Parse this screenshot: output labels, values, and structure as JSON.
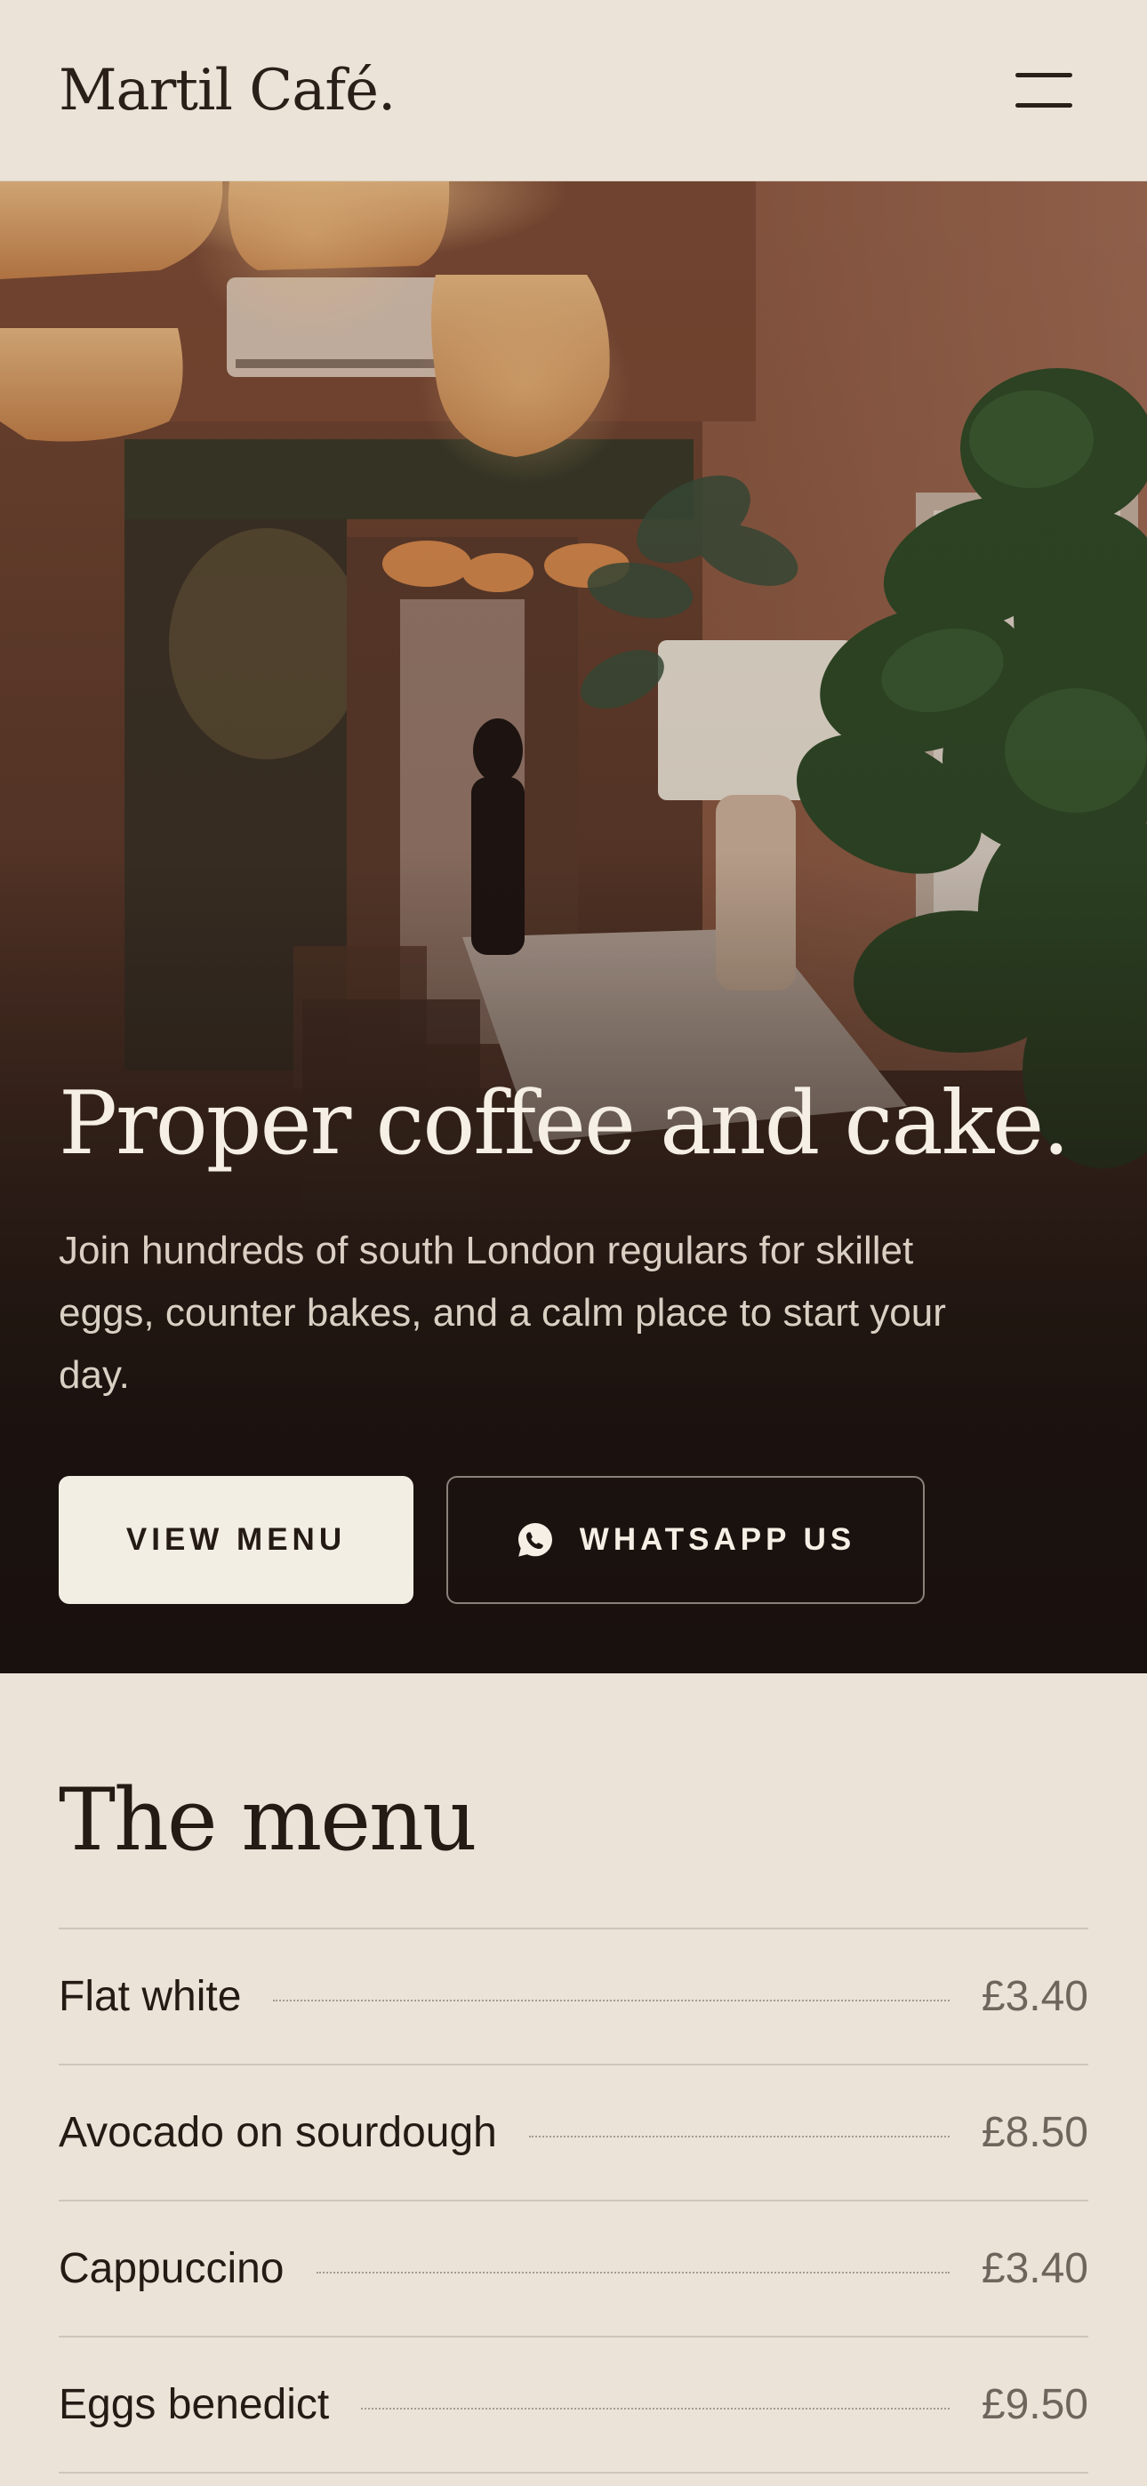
{
  "header": {
    "logo": "Martil Café.",
    "menu_icon": "hamburger-menu-icon"
  },
  "hero": {
    "image_description": "Photo of cafe interior",
    "title": "Proper coffee and cake.",
    "subtitle": "Join hundreds of south London regulars for skillet eggs, counter bakes, and a calm place to start your day.",
    "primary_button": "VIEW MENU",
    "secondary_button": "WHATSAPP US",
    "secondary_button_icon": "whatsapp-icon"
  },
  "menu": {
    "heading": "The menu",
    "items": [
      {
        "name": "Flat white",
        "price": "£3.40"
      },
      {
        "name": "Avocado on sourdough",
        "price": "£8.50"
      },
      {
        "name": "Cappuccino",
        "price": "£3.40"
      },
      {
        "name": "Eggs benedict",
        "price": "£9.50"
      }
    ]
  },
  "colors": {
    "background": "#ebe3d8",
    "text_dark": "#241b15",
    "hero_text": "#f5efe5",
    "primary_button_bg": "#f2eee4",
    "price_text": "#6e655d"
  }
}
